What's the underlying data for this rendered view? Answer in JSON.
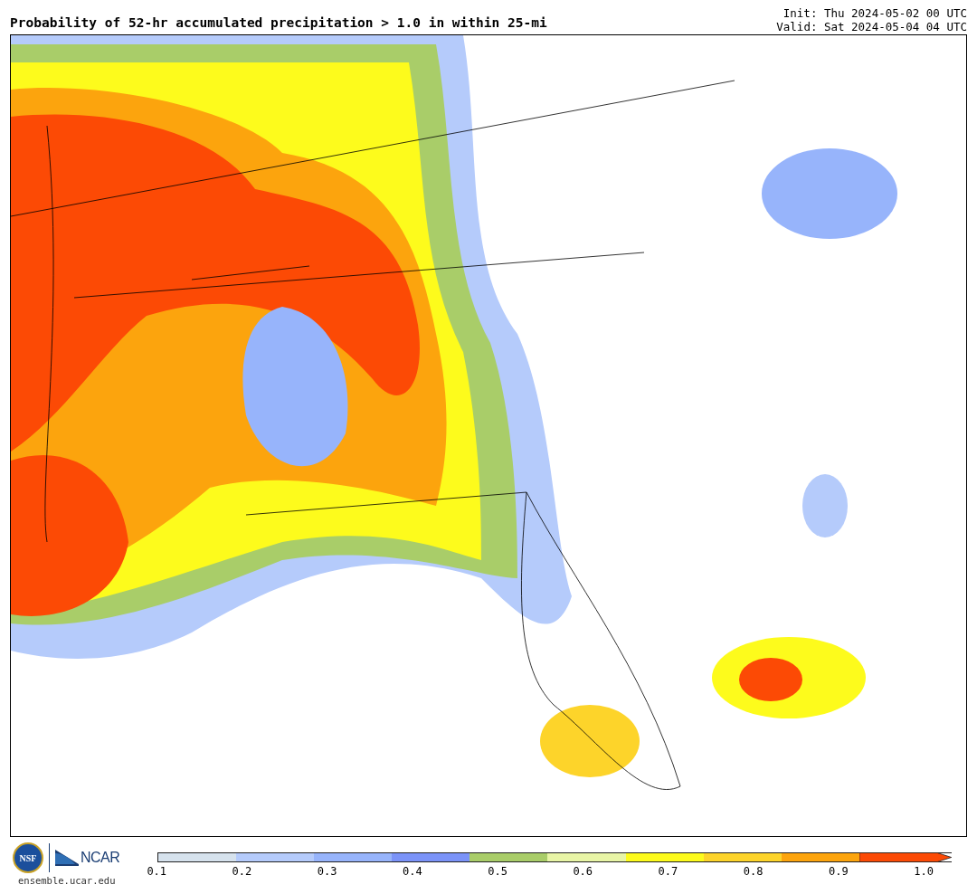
{
  "header": {
    "title": "Probability of 52-hr accumulated precipitation > 1.0 in within 25-mi",
    "init": "Init: Thu 2024-05-02 00 UTC",
    "valid": "Valid: Sat 2024-05-04 04 UTC"
  },
  "footer": {
    "logo_left": "NSF",
    "logo_right": "NCAR",
    "url": "ensemble.ucar.edu"
  },
  "colorbar": {
    "segments": [
      {
        "color": "#d6e2ed"
      },
      {
        "color": "#b5cbfb"
      },
      {
        "color": "#97b4fb"
      },
      {
        "color": "#7b93f8"
      },
      {
        "color": "#a9cd69"
      },
      {
        "color": "#e8f5a6"
      },
      {
        "color": "#fdfb1c"
      },
      {
        "color": "#fdd42a"
      },
      {
        "color": "#fca40d"
      },
      {
        "color": "#fc4a05"
      }
    ],
    "ticks": [
      "0.1",
      "0.2",
      "0.3",
      "0.4",
      "0.5",
      "0.6",
      "0.7",
      "0.8",
      "0.9",
      "1.0"
    ]
  }
}
